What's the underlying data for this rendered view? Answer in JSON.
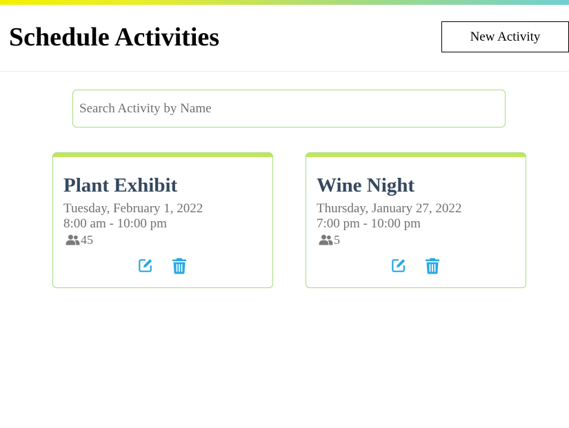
{
  "header": {
    "title": "Schedule Activities",
    "new_button_label": "New Activity"
  },
  "search": {
    "placeholder": "Search Activity by Name",
    "value": ""
  },
  "colors": {
    "accent_green": "#c4e45c",
    "border_green": "#a6dc80",
    "icon_blue": "#29a9e1",
    "title_slate": "#34495e"
  },
  "activities": [
    {
      "name": "Plant Exhibit",
      "date": "Tuesday, February 1, 2022",
      "time": "8:00 am - 10:00 pm",
      "attendees": "45",
      "people_icon": "users-icon",
      "edit_icon": "edit-icon",
      "delete_icon": "trash-icon"
    },
    {
      "name": "Wine Night",
      "date": "Thursday, January 27, 2022",
      "time": "7:00 pm - 10:00 pm",
      "attendees": "5",
      "people_icon": "users-icon",
      "edit_icon": "edit-icon",
      "delete_icon": "trash-icon"
    }
  ]
}
